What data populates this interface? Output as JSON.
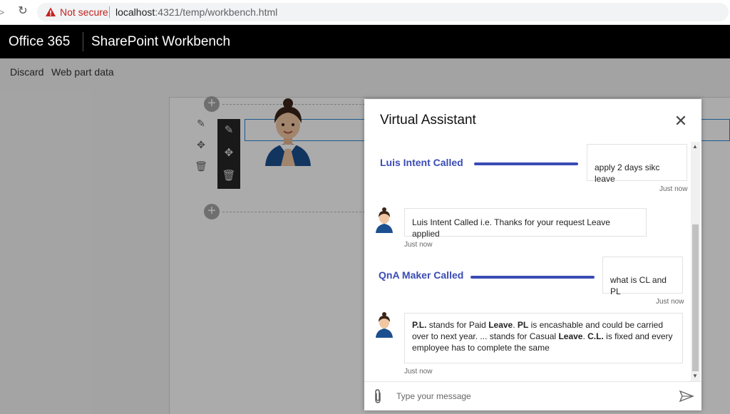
{
  "browser": {
    "nav_arrow": ">",
    "reload_glyph": "↻",
    "security_label": "Not secure",
    "url_host": "localhost",
    "url_path": ":4321/temp/workbench.html"
  },
  "suite_bar": {
    "product": "Office 365",
    "title": "SharePoint Workbench"
  },
  "command_bar": {
    "discard": "Discard",
    "web_part_data": "Web part data"
  },
  "canvas": {
    "add_glyph": "+",
    "tool_glyphs": {
      "edit": "✎",
      "move": "✥",
      "delete": "🗑"
    }
  },
  "chat": {
    "title": "Virtual Assistant",
    "close_glyph": "✕",
    "input_placeholder": "Type your message",
    "messages": [
      {
        "from": "user",
        "text": "apply 2 days sikc leave",
        "time": "Just now"
      },
      {
        "from": "bot",
        "text": "Luis Intent Called i.e. Thanks for your request Leave applied",
        "time": "Just now"
      },
      {
        "from": "user",
        "text": "what is CL and PL",
        "time": "Just now"
      },
      {
        "from": "bot",
        "time": "Just now",
        "runs": [
          {
            "t": "P.L.",
            "b": true
          },
          {
            "t": " stands for Paid ",
            "b": false
          },
          {
            "t": "Leave",
            "b": true
          },
          {
            "t": ". ",
            "b": false
          },
          {
            "t": "PL",
            "b": true
          },
          {
            "t": " is encashable and could be carried over to next year. ... stands for Casual ",
            "b": false
          },
          {
            "t": "Leave",
            "b": true
          },
          {
            "t": ". ",
            "b": false
          },
          {
            "t": "C.L.",
            "b": true
          },
          {
            "t": " is fixed and every employee has to complete the same",
            "b": false
          }
        ]
      }
    ]
  },
  "annotations": {
    "luis": "Luis Intent Called",
    "qna": "QnA Maker Called"
  },
  "colors": {
    "suite_bar": "#000000",
    "annotation": "#3a4bb5",
    "warning": "#c5221f",
    "selection": "#2b88d8"
  }
}
